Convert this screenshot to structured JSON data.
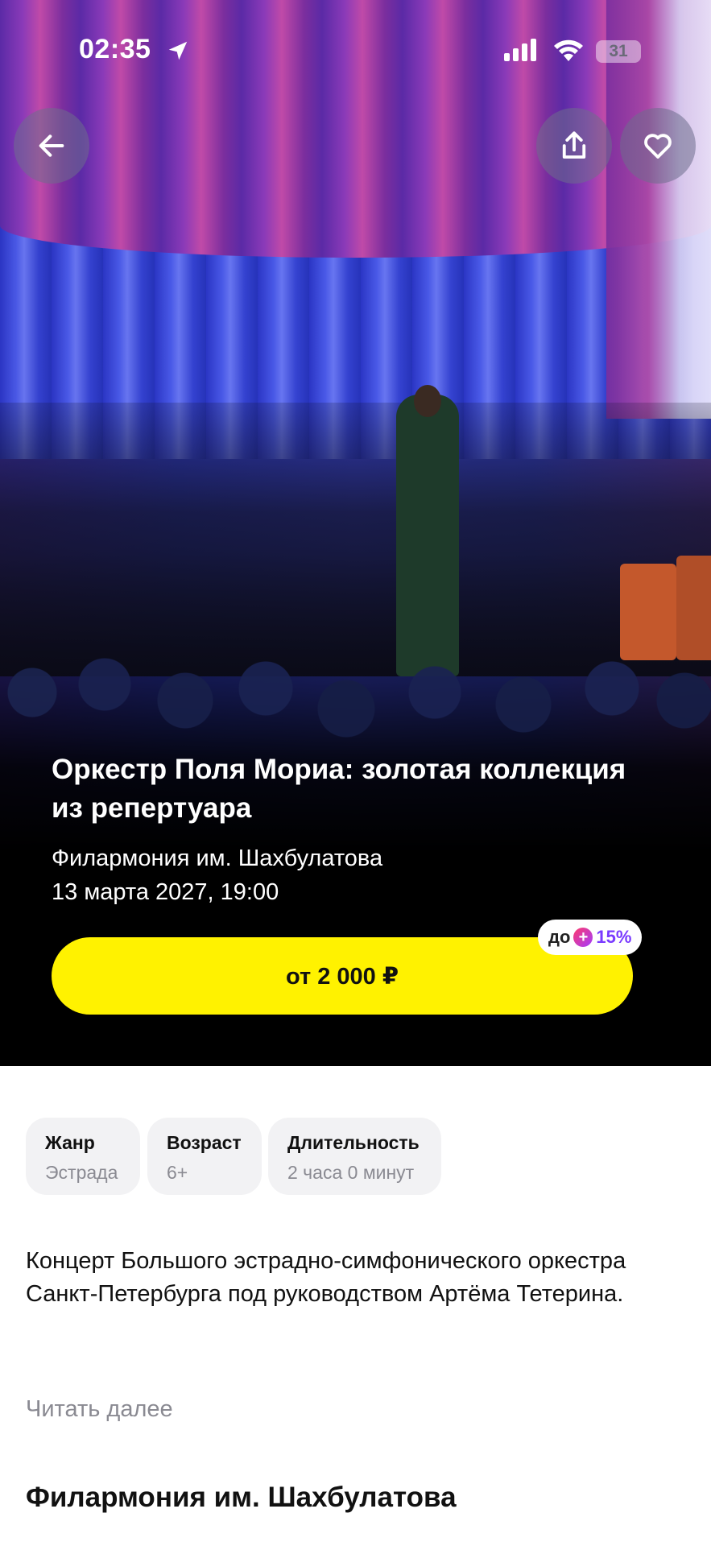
{
  "status_bar": {
    "time": "02:35",
    "battery": "31"
  },
  "event": {
    "title": "Оркестр Поля Мориа: золотая коллекция из репертуара",
    "venue": "Филармония им. Шахбулатова",
    "date": "13 марта 2027, 19:00",
    "price_button": "от 2 000 ₽",
    "cashback": {
      "prefix": "до",
      "percent": "15%"
    }
  },
  "info_chips": [
    {
      "label": "Жанр",
      "value": "Эстрада"
    },
    {
      "label": "Возраст",
      "value": "6+"
    },
    {
      "label": "Длительность",
      "value": "2 часа 0 минут"
    }
  ],
  "description": "Концерт Большого эстрадно-симфонического оркестра Санкт-Петербурга под руководством Артёма Тетерина.",
  "read_more": "Читать далее",
  "venue_section_title": "Филармония им. Шахбулатова",
  "colors": {
    "accent_yellow": "#fff200",
    "cashback_purple": "#7a3bff"
  },
  "icons": [
    "arrow-left-icon",
    "share-icon",
    "heart-icon",
    "location-arrow-icon",
    "signal-icon",
    "wifi-icon",
    "battery-icon"
  ]
}
